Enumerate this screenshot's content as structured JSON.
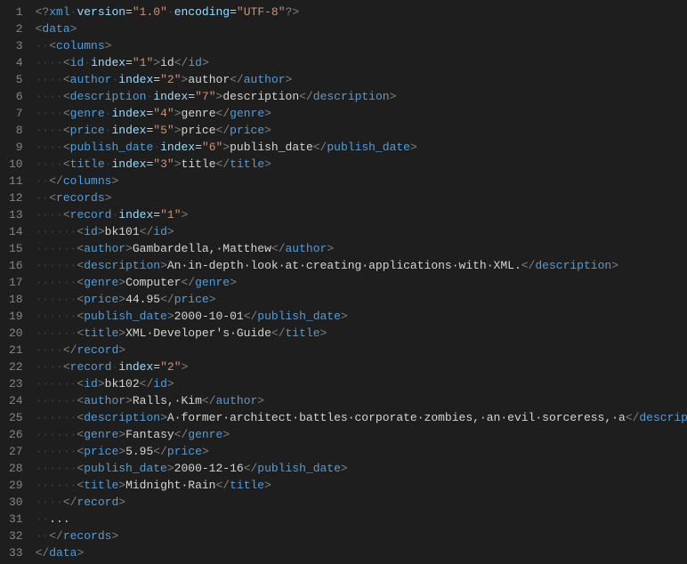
{
  "ws_dot": "·",
  "lines": [
    {
      "n": 1,
      "indent": 0,
      "kind": "pi",
      "txt_pi_open": "<?",
      "txt_pi_name": "xml",
      "attrs": [
        [
          "version",
          "1.0"
        ],
        [
          "encoding",
          "UTF-8"
        ]
      ],
      "txt_pi_close": "?>"
    },
    {
      "n": 2,
      "indent": 0,
      "kind": "open",
      "tag": "data"
    },
    {
      "n": 3,
      "indent": 2,
      "kind": "open",
      "tag": "columns"
    },
    {
      "n": 4,
      "indent": 4,
      "kind": "leaf",
      "tag": "id",
      "attrs": [
        [
          "index",
          "1"
        ]
      ],
      "text": "id"
    },
    {
      "n": 5,
      "indent": 4,
      "kind": "leaf",
      "tag": "author",
      "attrs": [
        [
          "index",
          "2"
        ]
      ],
      "text": "author"
    },
    {
      "n": 6,
      "indent": 4,
      "kind": "leaf",
      "tag": "description",
      "attrs": [
        [
          "index",
          "7"
        ]
      ],
      "text": "description"
    },
    {
      "n": 7,
      "indent": 4,
      "kind": "leaf",
      "tag": "genre",
      "attrs": [
        [
          "index",
          "4"
        ]
      ],
      "text": "genre"
    },
    {
      "n": 8,
      "indent": 4,
      "kind": "leaf",
      "tag": "price",
      "attrs": [
        [
          "index",
          "5"
        ]
      ],
      "text": "price"
    },
    {
      "n": 9,
      "indent": 4,
      "kind": "leaf",
      "tag": "publish_date",
      "attrs": [
        [
          "index",
          "6"
        ]
      ],
      "text": "publish_date"
    },
    {
      "n": 10,
      "indent": 4,
      "kind": "leaf",
      "tag": "title",
      "attrs": [
        [
          "index",
          "3"
        ]
      ],
      "text": "title"
    },
    {
      "n": 11,
      "indent": 2,
      "kind": "close",
      "tag": "columns"
    },
    {
      "n": 12,
      "indent": 2,
      "kind": "open",
      "tag": "records"
    },
    {
      "n": 13,
      "indent": 4,
      "kind": "open",
      "tag": "record",
      "attrs": [
        [
          "index",
          "1"
        ]
      ]
    },
    {
      "n": 14,
      "indent": 6,
      "kind": "leaf",
      "tag": "id",
      "text": "bk101"
    },
    {
      "n": 15,
      "indent": 6,
      "kind": "leaf",
      "tag": "author",
      "text": "Gambardella, Matthew"
    },
    {
      "n": 16,
      "indent": 6,
      "kind": "leaf",
      "tag": "description",
      "text": "An in-depth look at creating applications with XML."
    },
    {
      "n": 17,
      "indent": 6,
      "kind": "leaf",
      "tag": "genre",
      "text": "Computer"
    },
    {
      "n": 18,
      "indent": 6,
      "kind": "leaf",
      "tag": "price",
      "text": "44.95"
    },
    {
      "n": 19,
      "indent": 6,
      "kind": "leaf",
      "tag": "publish_date",
      "text": "2000-10-01"
    },
    {
      "n": 20,
      "indent": 6,
      "kind": "leaf",
      "tag": "title",
      "text": "XML Developer's Guide"
    },
    {
      "n": 21,
      "indent": 4,
      "kind": "close",
      "tag": "record"
    },
    {
      "n": 22,
      "indent": 4,
      "kind": "open",
      "tag": "record",
      "attrs": [
        [
          "index",
          "2"
        ]
      ]
    },
    {
      "n": 23,
      "indent": 6,
      "kind": "leaf",
      "tag": "id",
      "text": "bk102"
    },
    {
      "n": 24,
      "indent": 6,
      "kind": "leaf",
      "tag": "author",
      "text": "Ralls, Kim"
    },
    {
      "n": 25,
      "indent": 6,
      "kind": "leaf",
      "tag": "description",
      "text": "A former architect battles corporate zombies, an evil sorceress, a"
    },
    {
      "n": 26,
      "indent": 6,
      "kind": "leaf",
      "tag": "genre",
      "text": "Fantasy"
    },
    {
      "n": 27,
      "indent": 6,
      "kind": "leaf",
      "tag": "price",
      "text": "5.95"
    },
    {
      "n": 28,
      "indent": 6,
      "kind": "leaf",
      "tag": "publish_date",
      "text": "2000-12-16"
    },
    {
      "n": 29,
      "indent": 6,
      "kind": "leaf",
      "tag": "title",
      "text": "Midnight Rain"
    },
    {
      "n": 30,
      "indent": 4,
      "kind": "close",
      "tag": "record"
    },
    {
      "n": 31,
      "indent": 2,
      "kind": "ellipsis",
      "text": "..."
    },
    {
      "n": 32,
      "indent": 2,
      "kind": "close",
      "tag": "records"
    },
    {
      "n": 33,
      "indent": 0,
      "kind": "close",
      "tag": "data"
    }
  ]
}
